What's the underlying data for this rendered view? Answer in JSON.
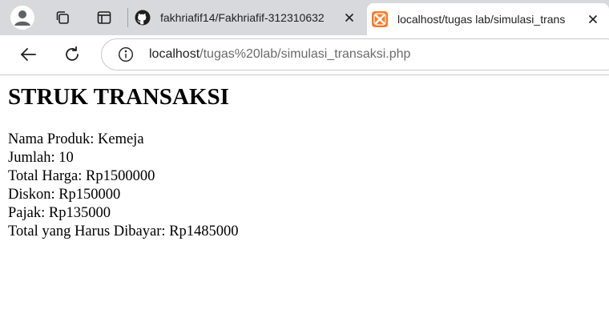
{
  "browser": {
    "tabs": [
      {
        "title": "fakhriafif14/Fakhriafif-312310632",
        "favicon": "github-icon",
        "active": false
      },
      {
        "title": "localhost/tugas lab/simulasi_trans",
        "favicon": "xampp-icon",
        "active": true
      }
    ],
    "address_bar": {
      "host": "localhost",
      "path": "/tugas%20lab/simulasi_transaksi.php"
    }
  },
  "page": {
    "heading": "STRUK TRANSAKSI",
    "lines": [
      "Nama Produk: Kemeja",
      "Jumlah: 10",
      "Total Harga: Rp1500000",
      "Diskon: Rp150000",
      "Pajak: Rp135000",
      "Total yang Harus Dibayar: Rp1485000"
    ]
  },
  "colors": {
    "tabstrip_bg": "#d7d9dd",
    "xampp_orange": "#fb7a24"
  }
}
